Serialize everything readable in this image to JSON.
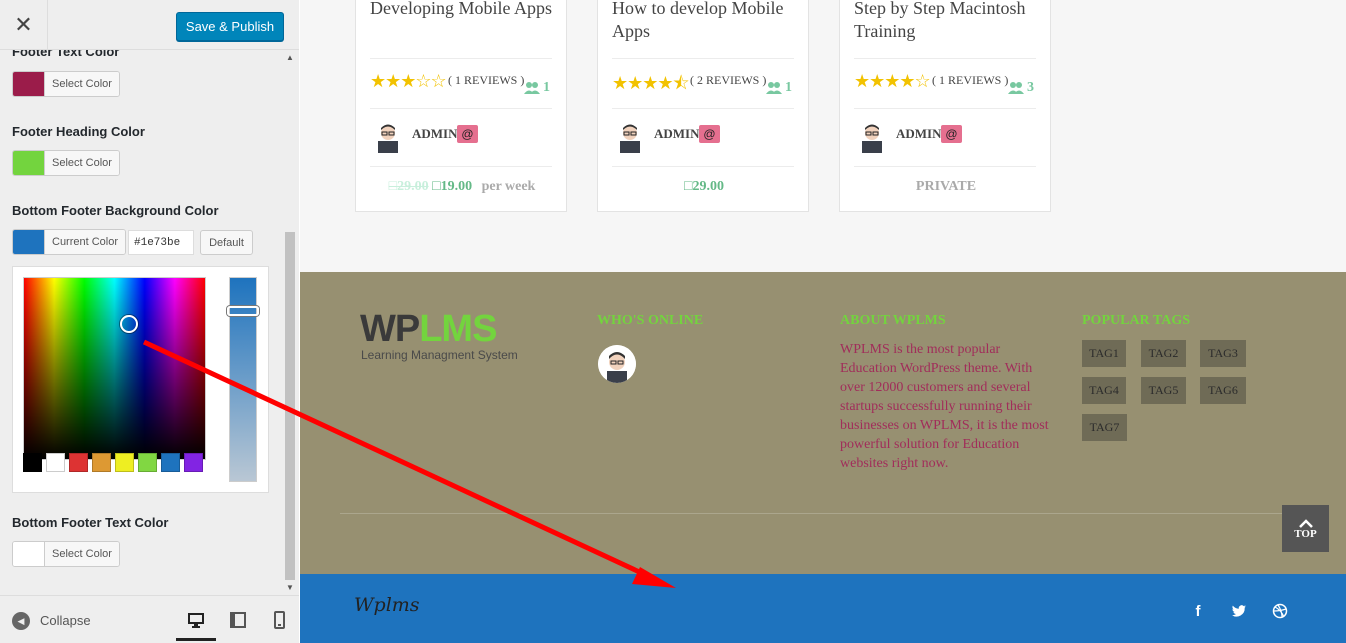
{
  "sidebar": {
    "header": {
      "close_glyph": "✕",
      "publish_label": "Save & Publish"
    },
    "controls": {
      "footer_text_color": {
        "label": "Footer Text Color",
        "button": "Select Color",
        "color": "#9b1c4a"
      },
      "footer_heading_color": {
        "label": "Footer Heading Color",
        "button": "Select Color",
        "color": "#73d43e"
      },
      "bottom_footer_bg_color": {
        "label": "Bottom Footer Background Color",
        "button": "Current Color",
        "color": "#1e73be",
        "hex_value": "#1e73be",
        "default_label": "Default"
      },
      "bottom_footer_text_color": {
        "label": "Bottom Footer Text Color",
        "button": "Select Color",
        "color": "#ffffff"
      }
    },
    "palette": [
      "#000000",
      "#ffffff",
      "#dd3333",
      "#dd9933",
      "#eeee22",
      "#81d742",
      "#1e73be",
      "#8224e3"
    ],
    "footer": {
      "collapse_label": "Collapse",
      "devices": [
        "desktop-icon",
        "tablet-icon",
        "mobile-icon"
      ]
    }
  },
  "courses": [
    {
      "title": "Developing Mobile Apps",
      "rating": 3,
      "reviews": "( 1 REVIEWS )",
      "students": "1",
      "author": "ADMIN",
      "badge": "@",
      "price_old": "29.00",
      "price_new": "19.00",
      "price_per": "per week",
      "currency_glyph": "□"
    },
    {
      "title": "How to develop Mobile Apps",
      "rating": 4.5,
      "reviews": "( 2 REVIEWS )",
      "students": "1",
      "author": "ADMIN",
      "badge": "@",
      "price_new": "29.00",
      "currency_glyph": "□"
    },
    {
      "title": "Step by Step Macintosh Training",
      "rating": 4,
      "reviews": "( 1 REVIEWS )",
      "students": "3",
      "author": "ADMIN",
      "badge": "@",
      "price_private": "PRIVATE"
    }
  ],
  "site_footer": {
    "logo": {
      "wp": "WP",
      "lms": "LMS",
      "tagline": "Learning Managment System"
    },
    "whos_online_title": "WHO'S ONLINE",
    "about_title": "ABOUT WPLMS",
    "about_text": "WPLMS is the most popular Education WordPress theme. With over 12000 customers and several startups successfully running their businesses on WPLMS, it is the most powerful solution for Education websites right now.",
    "tags_title": "POPULAR TAGS",
    "tags": [
      "TAG1",
      "TAG2",
      "TAG3",
      "TAG4",
      "TAG5",
      "TAG6",
      "TAG7"
    ],
    "top_label": "TOP",
    "colors": {
      "background": "#979071",
      "heading": "#73d43e",
      "text": "#a12d5a"
    }
  },
  "bottom_footer": {
    "logo_text": "Wplms",
    "social": [
      "facebook-icon",
      "twitter-icon",
      "dribbble-icon"
    ],
    "background": "#1e73be"
  },
  "annotation": {
    "type": "red-arrow",
    "color": "#ff0000"
  }
}
